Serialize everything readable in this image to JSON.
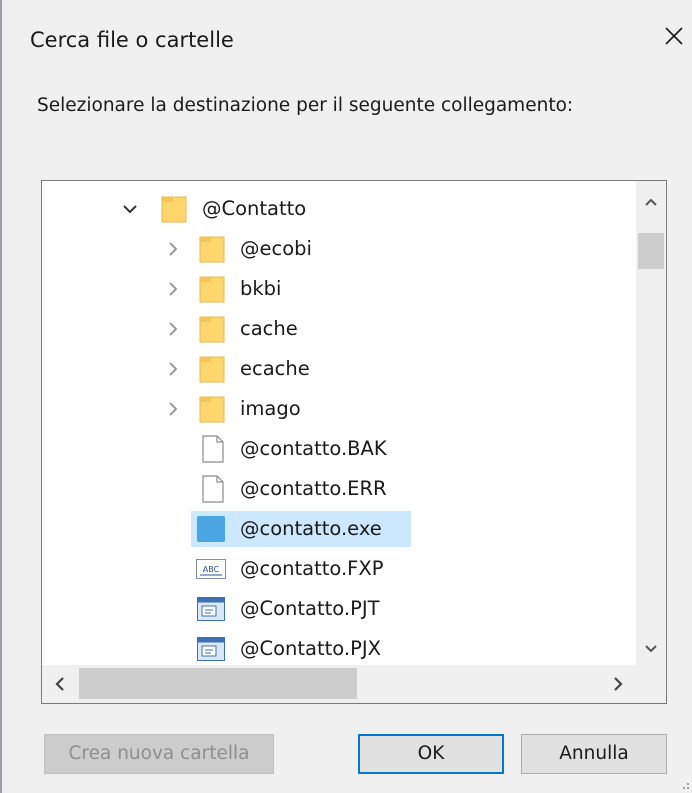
{
  "dialog": {
    "title": "Cerca file o cartelle",
    "prompt": "Selezionare la destinazione per il seguente collegamento:"
  },
  "tree": {
    "items": [
      {
        "label": "@Contatto",
        "icon": "folder-icon",
        "expander": "expanded"
      },
      {
        "label": "@ecobi",
        "icon": "folder-icon",
        "expander": "collapsed"
      },
      {
        "label": "bkbi",
        "icon": "folder-icon",
        "expander": "collapsed"
      },
      {
        "label": "cache",
        "icon": "folder-icon",
        "expander": "collapsed"
      },
      {
        "label": "ecache",
        "icon": "folder-icon",
        "expander": "collapsed"
      },
      {
        "label": "imago",
        "icon": "folder-icon",
        "expander": "collapsed"
      },
      {
        "label": "@contatto.BAK",
        "icon": "file-icon",
        "expander": "none"
      },
      {
        "label": "@contatto.ERR",
        "icon": "file-icon",
        "expander": "none"
      },
      {
        "label": "@contatto.exe",
        "icon": "exe-icon",
        "expander": "none",
        "selected": true
      },
      {
        "label": "@contatto.FXP",
        "icon": "abc-file-icon",
        "expander": "none"
      },
      {
        "label": "@Contatto.PJT",
        "icon": "project-file-icon",
        "expander": "none"
      },
      {
        "label": "@Contatto.PJX",
        "icon": "project-file-icon",
        "expander": "none"
      }
    ]
  },
  "buttons": {
    "new_folder": "Crea nuova cartella",
    "ok": "OK",
    "cancel": "Annulla"
  },
  "colors": {
    "selection": "#cce8ff",
    "folder": "#ffd66b",
    "accent": "#0078d7"
  }
}
